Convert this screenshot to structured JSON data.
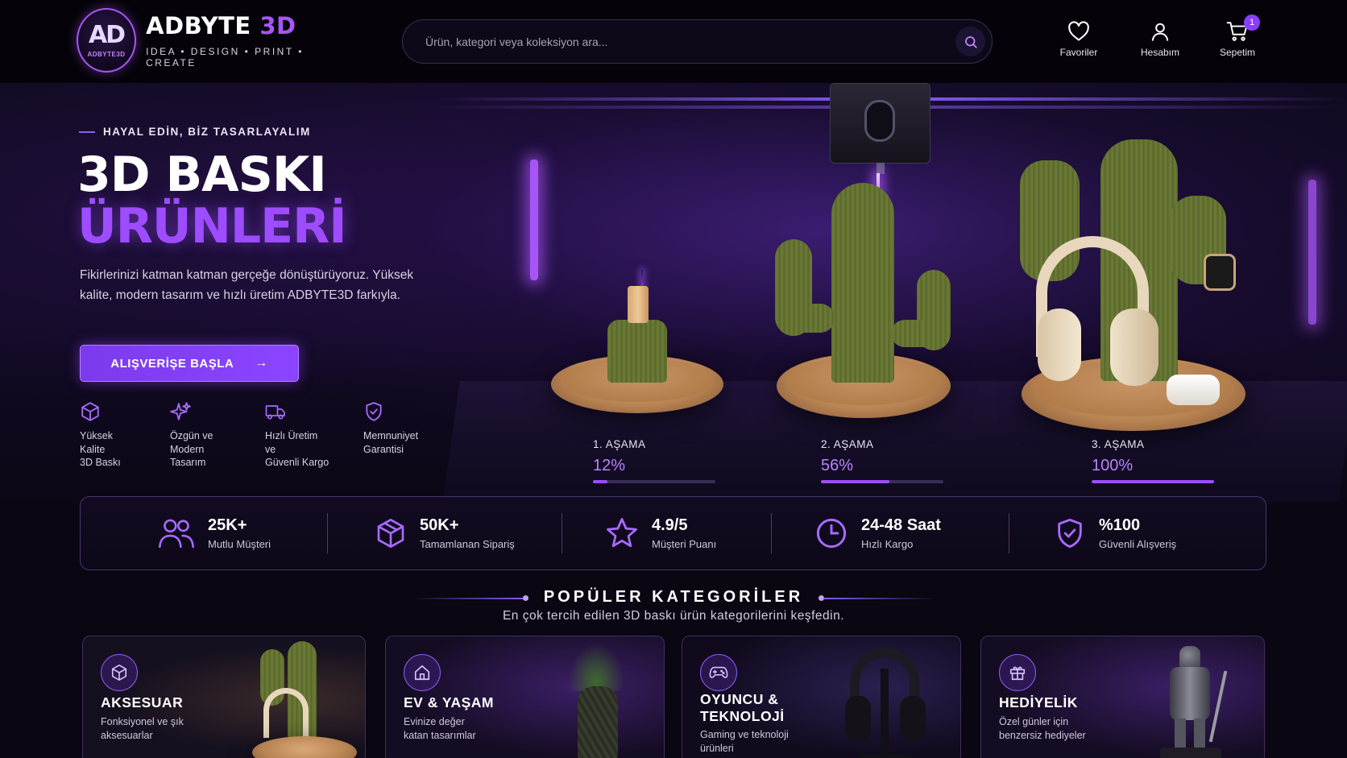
{
  "header": {
    "brand_white": "ADBYTE",
    "brand_purple": "3D",
    "logo_mono": "AD",
    "logo_mini": "ADBYTE3D",
    "tagline": "IDEA • DESIGN • PRINT • CREATE",
    "search_placeholder": "Ürün, kategori veya koleksiyon ara...",
    "nav": {
      "favorites": "Favoriler",
      "account": "Hesabım",
      "cart": "Sepetim",
      "cart_count": "1"
    }
  },
  "hero": {
    "eyebrow": "HAYAL EDİN, BİZ TASARLAYALIM",
    "title_line1": "3D BASKI",
    "title_line2": "ÜRÜNLERİ",
    "description": "Fikirlerinizi katman katman gerçeğe dönüştürüyoruz. Yüksek kalite, modern tasarım ve hızlı üretim ADBYTE3D farkıyla.",
    "cta_label": "ALIŞVERİŞE BAŞLA",
    "cta_arrow": "→",
    "features": [
      {
        "icon": "cube-icon",
        "text": "Yüksek\nKalite\n3D Baskı"
      },
      {
        "icon": "sparkle-icon",
        "text": "Özgün ve\nModern\nTasarım"
      },
      {
        "icon": "truck-icon",
        "text": "Hızlı Üretim\nve\nGüvenli Kargo"
      },
      {
        "icon": "shield-check-icon",
        "text": "Memnuniyet\nGarantisi"
      }
    ],
    "stages": [
      {
        "label": "1. AŞAMA",
        "percent_text": "12%",
        "progress": 0.12
      },
      {
        "label": "2. AŞAMA",
        "percent_text": "56%",
        "progress": 0.56
      },
      {
        "label": "3. AŞAMA",
        "percent_text": "100%",
        "progress": 1.0
      }
    ]
  },
  "stats": [
    {
      "icon": "users-icon",
      "value": "25K+",
      "label": "Mutlu Müşteri"
    },
    {
      "icon": "package-icon",
      "value": "50K+",
      "label": "Tamamlanan Sipariş"
    },
    {
      "icon": "star-icon",
      "value": "4.9/5",
      "label": "Müşteri Puanı"
    },
    {
      "icon": "clock-icon",
      "value": "24-48 Saat",
      "label": "Hızlı Kargo"
    },
    {
      "icon": "shield-check-icon",
      "value": "%100",
      "label": "Güvenli Alışveriş"
    }
  ],
  "categories_section": {
    "title": "POPÜLER KATEGORİLER",
    "subtitle": "En çok tercih edilen 3D baskı ürün kategorilerini keşfedin."
  },
  "categories": [
    {
      "icon": "cube-icon",
      "title": "AKSESUAR",
      "desc": "Fonksiyonel ve şık\naksesuarlar"
    },
    {
      "icon": "home-icon",
      "title": "EV & YAŞAM",
      "desc": "Evinize değer\nkatan tasarımlar"
    },
    {
      "icon": "gamepad-icon",
      "title": "OYUNCU &\nTEKNOLOJİ",
      "desc": "Gaming ve teknoloji\nürünleri"
    },
    {
      "icon": "gift-icon",
      "title": "HEDİYELİK",
      "desc": "Özel günler için\nbenzersiz hediyeler"
    }
  ],
  "colors": {
    "accent": "#9d4dff",
    "background": "#0a0612",
    "cactus": "#6d7c36",
    "plate": "#c99466"
  }
}
